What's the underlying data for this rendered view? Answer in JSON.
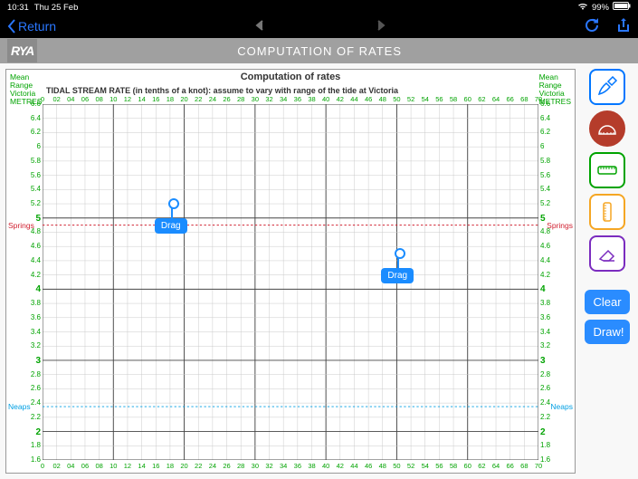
{
  "status": {
    "time": "10:31",
    "date": "Thu 25 Feb",
    "battery_pct": "99%"
  },
  "nav": {
    "return_label": "Return"
  },
  "title": {
    "logo": "RYA",
    "text": "COMPUTATION OF RATES"
  },
  "chart_data": {
    "type": "line",
    "title": "Computation of rates",
    "subtitle": "TIDAL STREAM RATE (in tenths of a knot): assume to vary with range of the tide at Victoria",
    "axis_caption": "Mean\nRange\nVictoria\nMETRES",
    "xlabel": "",
    "ylabel": "",
    "x": [
      0,
      2,
      4,
      6,
      8,
      10,
      12,
      14,
      16,
      18,
      20,
      22,
      24,
      26,
      28,
      30,
      32,
      34,
      36,
      38,
      40,
      42,
      44,
      46,
      48,
      50,
      52,
      54,
      56,
      58,
      60,
      62,
      64,
      66,
      68,
      70
    ],
    "xlim": [
      0,
      70
    ],
    "ylim": [
      1.6,
      6.6
    ],
    "y_major": [
      2,
      3,
      4,
      5
    ],
    "y_minor": [
      1.6,
      1.8,
      2.2,
      2.4,
      2.6,
      2.8,
      3.2,
      3.4,
      3.6,
      3.8,
      4.2,
      4.4,
      4.6,
      4.8,
      5.2,
      5.4,
      5.6,
      5.8,
      6,
      6.2,
      6.4,
      6.6
    ],
    "springs_level": 4.9,
    "springs_label": "Springs",
    "neaps_level": 2.35,
    "neaps_label": "Neaps",
    "handles": [
      {
        "x": 18,
        "y": 5.1,
        "label": "Drag"
      },
      {
        "x": 50,
        "y": 4.4,
        "label": "Drag"
      }
    ]
  },
  "toolbar": {
    "clear_label": "Clear",
    "draw_label": "Draw!"
  }
}
